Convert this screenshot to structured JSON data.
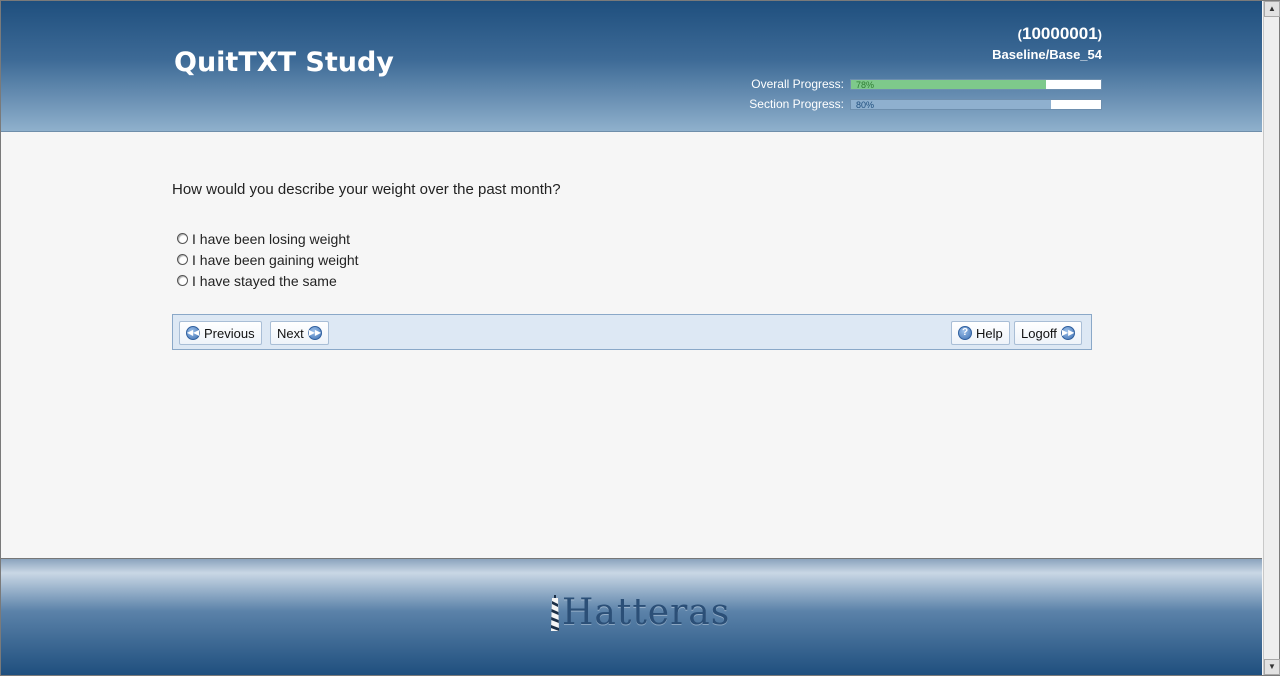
{
  "header": {
    "title": "QuitTXT Study",
    "participant_id": "10000001",
    "paren_open": "(",
    "paren_close": ")",
    "visit": "Baseline/Base_54",
    "overall_progress_label": "Overall Progress:",
    "overall_progress_text": "78%",
    "overall_progress_value": 0.78,
    "section_progress_label": "Section Progress:",
    "section_progress_text": "80%",
    "section_progress_value": 0.8
  },
  "question": {
    "text": "How would you describe your weight over the past month?",
    "options": [
      "I have been losing weight",
      "I have been gaining weight",
      "I have stayed the same"
    ]
  },
  "nav": {
    "previous_label": "Previous",
    "next_label": "Next",
    "help_label": "Help",
    "logoff_label": "Logoff"
  },
  "footer": {
    "logo_text": "Hatteras"
  },
  "colors": {
    "header_dark": "#1f4f7e",
    "overall_fill": "#7ec98b",
    "section_fill": "#8fb0cf"
  }
}
